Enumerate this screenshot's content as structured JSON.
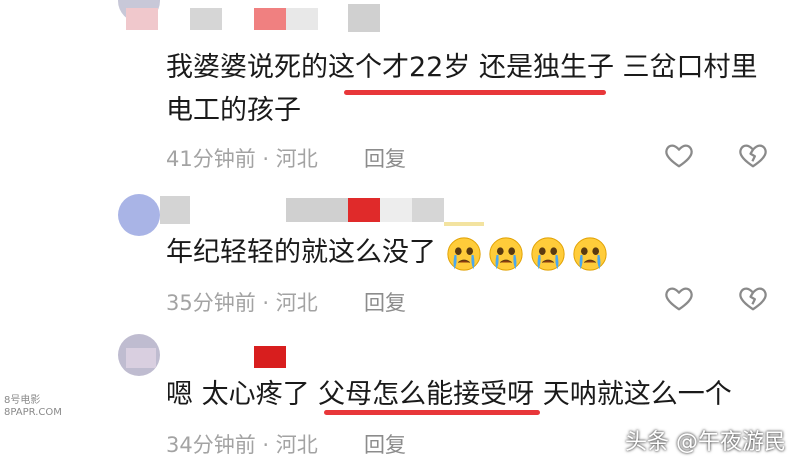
{
  "comments": [
    {
      "text_line1": "我婆婆说死的这个才22岁 还是独生子 三岔口村里",
      "text_line2": "电工的孩子",
      "meta": "41分钟前 · 河北",
      "reply_label": "回复",
      "avatar_color": "#c8c8d8"
    },
    {
      "text": "年纪轻轻的就这么没了",
      "emoji_count": 4,
      "meta": "35分钟前 · 河北",
      "reply_label": "回复",
      "avatar_color": "#a9b4e6"
    },
    {
      "text": "嗯 太心疼了 父母怎么能接受呀 天呐就这么一个",
      "meta": "34分钟前 · 河北",
      "reply_label": "回复",
      "avatar_color": "#bfbcd0"
    }
  ],
  "icons": [
    "heart-icon",
    "broken-heart-icon",
    "crying-emoji-icon"
  ],
  "colors": {
    "underline": "#e8373a",
    "meta": "#a3a3a3",
    "text": "#1a1a1a"
  },
  "watermark": {
    "left_line1": "8号电影",
    "left_line2": "8PAPR.COM",
    "right": "头条 @午夜游民"
  }
}
